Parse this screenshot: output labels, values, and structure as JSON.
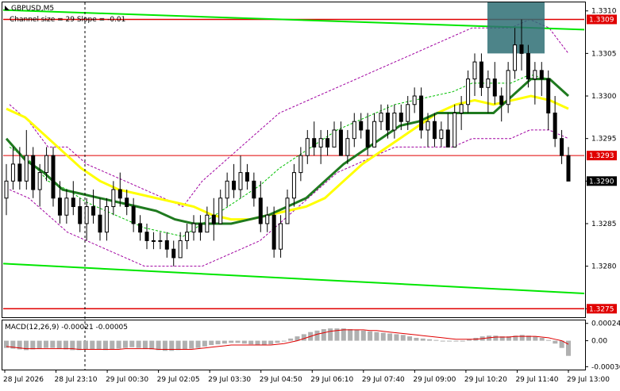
{
  "window": {
    "symbol_title": "GBPUSD,M5",
    "indicator_note": "Channel size = 29 Slope = -0.01"
  },
  "colors": {
    "bull_candle": "#000000",
    "bear_candle": "#000000",
    "ma_fast": "#1f7a1f",
    "ma_slow": "#ffff00",
    "channel": "#00e600",
    "level_line": "#e00000",
    "bollinger": "#a000a0",
    "macd_hist": "#b0b0b0",
    "macd_signal": "#e00000",
    "highlight_box": "#2e6f74"
  },
  "chart_data": [
    {
      "type": "candlestick",
      "title": "GBPUSD,M5",
      "subtitle": "Channel size = 29 Slope = -0.01",
      "ylim": [
        1.3274,
        1.3311
      ],
      "y_ticks": [
        "1.3310",
        "1.3305",
        "1.3300",
        "1.3295",
        "1.3290",
        "1.3285",
        "1.3280",
        "1.3275"
      ],
      "x_ticks": [
        "28 Jul 2026",
        "28 Jul 23:10",
        "29 Jul 00:30",
        "29 Jul 02:05",
        "29 Jul 03:30",
        "29 Jul 04:50",
        "29 Jul 06:10",
        "29 Jul 07:40",
        "29 Jul 09:00",
        "29 Jul 10:20",
        "29 Jul 11:40",
        "29 Jul 13:00"
      ],
      "price_labels": [
        {
          "text": "1.3309",
          "value": 1.3309,
          "style": "red"
        },
        {
          "text": "1.3293",
          "value": 1.3293,
          "style": "red"
        },
        {
          "text": "1.3290",
          "value": 1.329,
          "style": "dark"
        },
        {
          "text": "1.3275",
          "value": 1.3275,
          "style": "red"
        }
      ],
      "horizontal_levels": [
        1.3309,
        1.3293,
        1.3275
      ],
      "channel_upper": {
        "start": 1.33101,
        "end": 1.33078
      },
      "channel_lower": {
        "start": 1.32803,
        "end": 1.32768
      },
      "ma_slow": [
        1.32985,
        1.32975,
        1.32955,
        1.32935,
        1.32915,
        1.329,
        1.3289,
        1.32885,
        1.3288,
        1.32875,
        1.3287,
        1.3286,
        1.32855,
        1.32855,
        1.3286,
        1.32865,
        1.3287,
        1.3288,
        1.329,
        1.3292,
        1.32935,
        1.3295,
        1.32965,
        1.3298,
        1.3299,
        1.32995,
        1.3299,
        1.32995,
        1.33,
        1.32995,
        1.32985
      ],
      "ma_fast": [
        1.3295,
        1.32925,
        1.3291,
        1.3289,
        1.32885,
        1.3288,
        1.32875,
        1.3287,
        1.32865,
        1.32855,
        1.3285,
        1.3285,
        1.3285,
        1.32855,
        1.3286,
        1.3287,
        1.3288,
        1.329,
        1.3292,
        1.32935,
        1.3295,
        1.32965,
        1.3297,
        1.3298,
        1.3298,
        1.3298,
        1.3298,
        1.33,
        1.3302,
        1.3302,
        1.33
      ],
      "bands_upper": [
        1.3299,
        1.3297,
        1.3294,
        1.3294,
        1.3292,
        1.3291,
        1.329,
        1.3289,
        1.3288,
        1.3287,
        1.329,
        1.3292,
        1.3294,
        1.3296,
        1.3298,
        1.3299,
        1.33,
        1.3301,
        1.3302,
        1.3303,
        1.3304,
        1.3305,
        1.3306,
        1.3307,
        1.3308,
        1.3308,
        1.3308,
        1.3309,
        1.3308,
        1.3305
      ],
      "bands_lower": [
        1.3289,
        1.3288,
        1.3286,
        1.3284,
        1.3283,
        1.3282,
        1.3281,
        1.328,
        1.328,
        1.328,
        1.328,
        1.3281,
        1.3282,
        1.3283,
        1.3285,
        1.3287,
        1.3289,
        1.3291,
        1.3292,
        1.3293,
        1.3294,
        1.3294,
        1.3294,
        1.3294,
        1.3295,
        1.3295,
        1.3295,
        1.3296,
        1.3296,
        1.3295
      ],
      "candles": [
        [
          1.3288,
          1.3292,
          1.3286,
          1.329
        ],
        [
          1.329,
          1.3294,
          1.3289,
          1.3292
        ],
        [
          1.3292,
          1.3294,
          1.3289,
          1.329
        ],
        [
          1.329,
          1.3296,
          1.3289,
          1.3293
        ],
        [
          1.3293,
          1.3294,
          1.3288,
          1.3289
        ],
        [
          1.3289,
          1.3292,
          1.3287,
          1.3291
        ],
        [
          1.3291,
          1.3294,
          1.329,
          1.3293
        ],
        [
          1.3293,
          1.3294,
          1.3287,
          1.3288
        ],
        [
          1.3288,
          1.329,
          1.3285,
          1.3286
        ],
        [
          1.3286,
          1.3289,
          1.3285,
          1.3288
        ],
        [
          1.3288,
          1.329,
          1.3286,
          1.3287
        ],
        [
          1.3287,
          1.3288,
          1.3284,
          1.3285
        ],
        [
          1.3285,
          1.3288,
          1.3283,
          1.3287
        ],
        [
          1.3287,
          1.3289,
          1.3285,
          1.3286
        ],
        [
          1.3286,
          1.3288,
          1.3283,
          1.3284
        ],
        [
          1.3284,
          1.3288,
          1.3283,
          1.3287
        ],
        [
          1.3287,
          1.329,
          1.3286,
          1.3289
        ],
        [
          1.3289,
          1.3291,
          1.3287,
          1.3288
        ],
        [
          1.3288,
          1.3289,
          1.3286,
          1.3287
        ],
        [
          1.3287,
          1.3288,
          1.3284,
          1.3285
        ],
        [
          1.3285,
          1.3286,
          1.3283,
          1.3284
        ],
        [
          1.3284,
          1.3285,
          1.3282,
          1.3283
        ],
        [
          1.3283,
          1.3284,
          1.3282,
          1.3283
        ],
        [
          1.3283,
          1.3284,
          1.3282,
          1.3283
        ],
        [
          1.3283,
          1.3284,
          1.3281,
          1.3282
        ],
        [
          1.3282,
          1.3283,
          1.328,
          1.3281
        ],
        [
          1.3281,
          1.3284,
          1.3281,
          1.3283
        ],
        [
          1.3283,
          1.3285,
          1.3282,
          1.3284
        ],
        [
          1.3284,
          1.3286,
          1.3283,
          1.3285
        ],
        [
          1.3285,
          1.3286,
          1.3283,
          1.3284
        ],
        [
          1.3284,
          1.3287,
          1.3284,
          1.3286
        ],
        [
          1.3286,
          1.3288,
          1.3283,
          1.3285
        ],
        [
          1.3285,
          1.3289,
          1.3285,
          1.3288
        ],
        [
          1.3288,
          1.3291,
          1.3287,
          1.329
        ],
        [
          1.329,
          1.3292,
          1.3288,
          1.3289
        ],
        [
          1.3289,
          1.3293,
          1.3288,
          1.3291
        ],
        [
          1.3291,
          1.3292,
          1.3289,
          1.329
        ],
        [
          1.329,
          1.3291,
          1.3287,
          1.3288
        ],
        [
          1.3288,
          1.329,
          1.3284,
          1.3285
        ],
        [
          1.3285,
          1.3287,
          1.3284,
          1.3286
        ],
        [
          1.3286,
          1.3287,
          1.3281,
          1.3282
        ],
        [
          1.3282,
          1.3286,
          1.3281,
          1.3285
        ],
        [
          1.3285,
          1.3289,
          1.3285,
          1.3288
        ],
        [
          1.3288,
          1.3292,
          1.3287,
          1.3291
        ],
        [
          1.3291,
          1.3294,
          1.329,
          1.3293
        ],
        [
          1.3293,
          1.3296,
          1.3292,
          1.3295
        ],
        [
          1.3295,
          1.3297,
          1.3293,
          1.3294
        ],
        [
          1.3294,
          1.3296,
          1.3292,
          1.3295
        ],
        [
          1.3295,
          1.3296,
          1.3293,
          1.3294
        ],
        [
          1.3294,
          1.3297,
          1.3294,
          1.3296
        ],
        [
          1.3296,
          1.3297,
          1.3293,
          1.3293
        ],
        [
          1.3293,
          1.3296,
          1.3292,
          1.3295
        ],
        [
          1.3295,
          1.3298,
          1.3294,
          1.3297
        ],
        [
          1.3297,
          1.3298,
          1.3295,
          1.3296
        ],
        [
          1.3296,
          1.3298,
          1.3293,
          1.3294
        ],
        [
          1.3294,
          1.3298,
          1.3294,
          1.3297
        ],
        [
          1.3297,
          1.3299,
          1.3296,
          1.3298
        ],
        [
          1.3298,
          1.3299,
          1.3295,
          1.3296
        ],
        [
          1.3296,
          1.3299,
          1.3295,
          1.3298
        ],
        [
          1.3298,
          1.3299,
          1.3296,
          1.3297
        ],
        [
          1.3297,
          1.33,
          1.3296,
          1.3299
        ],
        [
          1.3299,
          1.3301,
          1.3298,
          1.33
        ],
        [
          1.33,
          1.3301,
          1.3295,
          1.3296
        ],
        [
          1.3296,
          1.3298,
          1.3294,
          1.3297
        ],
        [
          1.3297,
          1.3298,
          1.3294,
          1.3295
        ],
        [
          1.3295,
          1.3297,
          1.3294,
          1.3296
        ],
        [
          1.3296,
          1.3298,
          1.3294,
          1.3294
        ],
        [
          1.3294,
          1.3299,
          1.3294,
          1.3298
        ],
        [
          1.3298,
          1.33,
          1.3296,
          1.3299
        ],
        [
          1.3299,
          1.3303,
          1.3298,
          1.3302
        ],
        [
          1.3302,
          1.3305,
          1.33,
          1.3304
        ],
        [
          1.3304,
          1.3305,
          1.33,
          1.3301
        ],
        [
          1.3301,
          1.3303,
          1.3298,
          1.3302
        ],
        [
          1.3302,
          1.3304,
          1.3299,
          1.33
        ],
        [
          1.33,
          1.3301,
          1.3297,
          1.3299
        ],
        [
          1.3299,
          1.3304,
          1.3298,
          1.3303
        ],
        [
          1.3303,
          1.3308,
          1.3302,
          1.3306
        ],
        [
          1.3306,
          1.3309,
          1.3303,
          1.3305
        ],
        [
          1.3305,
          1.3306,
          1.3301,
          1.3302
        ],
        [
          1.3302,
          1.3304,
          1.3299,
          1.3303
        ],
        [
          1.3303,
          1.3304,
          1.33,
          1.3302
        ],
        [
          1.3302,
          1.3303,
          1.3296,
          1.3298
        ],
        [
          1.3298,
          1.33,
          1.3294,
          1.3295
        ],
        [
          1.3295,
          1.3296,
          1.3292,
          1.3293
        ],
        [
          1.3293,
          1.3294,
          1.329,
          1.329
        ]
      ],
      "macd": {
        "label": "MACD(12,26,9) -0.00021 -0.00005",
        "ylim": [
          -0.0004,
          0.00027
        ],
        "y_ticks": [
          "0.00024",
          "0.00",
          "-0.00036"
        ],
        "hist": [
          -0.0001,
          -0.00011,
          -0.00012,
          -0.00013,
          -0.00012,
          -0.00011,
          -0.0001,
          -0.0001,
          -0.00011,
          -0.00012,
          -0.00013,
          -0.00013,
          -0.00012,
          -0.00012,
          -0.00012,
          -0.00013,
          -0.00012,
          -0.00011,
          -0.0001,
          -9e-05,
          -0.0001,
          -0.00011,
          -0.00012,
          -0.00013,
          -0.00014,
          -0.00014,
          -0.00013,
          -0.00012,
          -0.00011,
          -0.0001,
          -8e-05,
          -6e-05,
          -5e-05,
          -4e-05,
          -3e-05,
          -3e-05,
          -4e-05,
          -5e-05,
          -6e-05,
          -6e-05,
          -5e-05,
          -3e-05,
          0.0,
          3e-05,
          6e-05,
          9e-05,
          0.00012,
          0.00014,
          0.00016,
          0.00017,
          0.00017,
          0.00017,
          0.00016,
          0.00015,
          0.00014,
          0.00013,
          0.00012,
          0.00011,
          0.0001,
          9e-05,
          8e-05,
          6e-05,
          4e-05,
          3e-05,
          2e-05,
          1e-05,
          0.0,
          -1e-05,
          -1e-05,
          0.0,
          2e-05,
          4e-05,
          6e-05,
          7e-05,
          7e-05,
          6e-05,
          6e-05,
          7e-05,
          8e-05,
          7e-05,
          6e-05,
          4e-05,
          1e-05,
          -4e-05,
          -0.0001,
          -0.00021
        ],
        "signal": [
          -8e-05,
          -9e-05,
          -0.0001,
          -0.00011,
          -0.00011,
          -0.00011,
          -0.00011,
          -0.00011,
          -0.00011,
          -0.00011,
          -0.00011,
          -0.00012,
          -0.00012,
          -0.00012,
          -0.00012,
          -0.00012,
          -0.00012,
          -0.00012,
          -0.00011,
          -0.00011,
          -0.00011,
          -0.00011,
          -0.00011,
          -0.00012,
          -0.00012,
          -0.00012,
          -0.00012,
          -0.00012,
          -0.00012,
          -0.00011,
          -0.0001,
          -9e-05,
          -8e-05,
          -7e-05,
          -6e-05,
          -6e-05,
          -6e-05,
          -6e-05,
          -6e-05,
          -6e-05,
          -6e-05,
          -5e-05,
          -4e-05,
          -2e-05,
          0.0,
          3e-05,
          6e-05,
          9e-05,
          0.00011,
          0.00013,
          0.00014,
          0.00015,
          0.00015,
          0.00015,
          0.00015,
          0.00014,
          0.00014,
          0.00013,
          0.00012,
          0.00011,
          0.0001,
          9e-05,
          8e-05,
          7e-05,
          6e-05,
          5e-05,
          4e-05,
          3e-05,
          2e-05,
          2e-05,
          2e-05,
          2e-05,
          3e-05,
          4e-05,
          5e-05,
          5e-05,
          5e-05,
          6e-05,
          6e-05,
          6e-05,
          6e-05,
          5e-05,
          4e-05,
          2e-05,
          0.0,
          -5e-05
        ]
      }
    }
  ]
}
